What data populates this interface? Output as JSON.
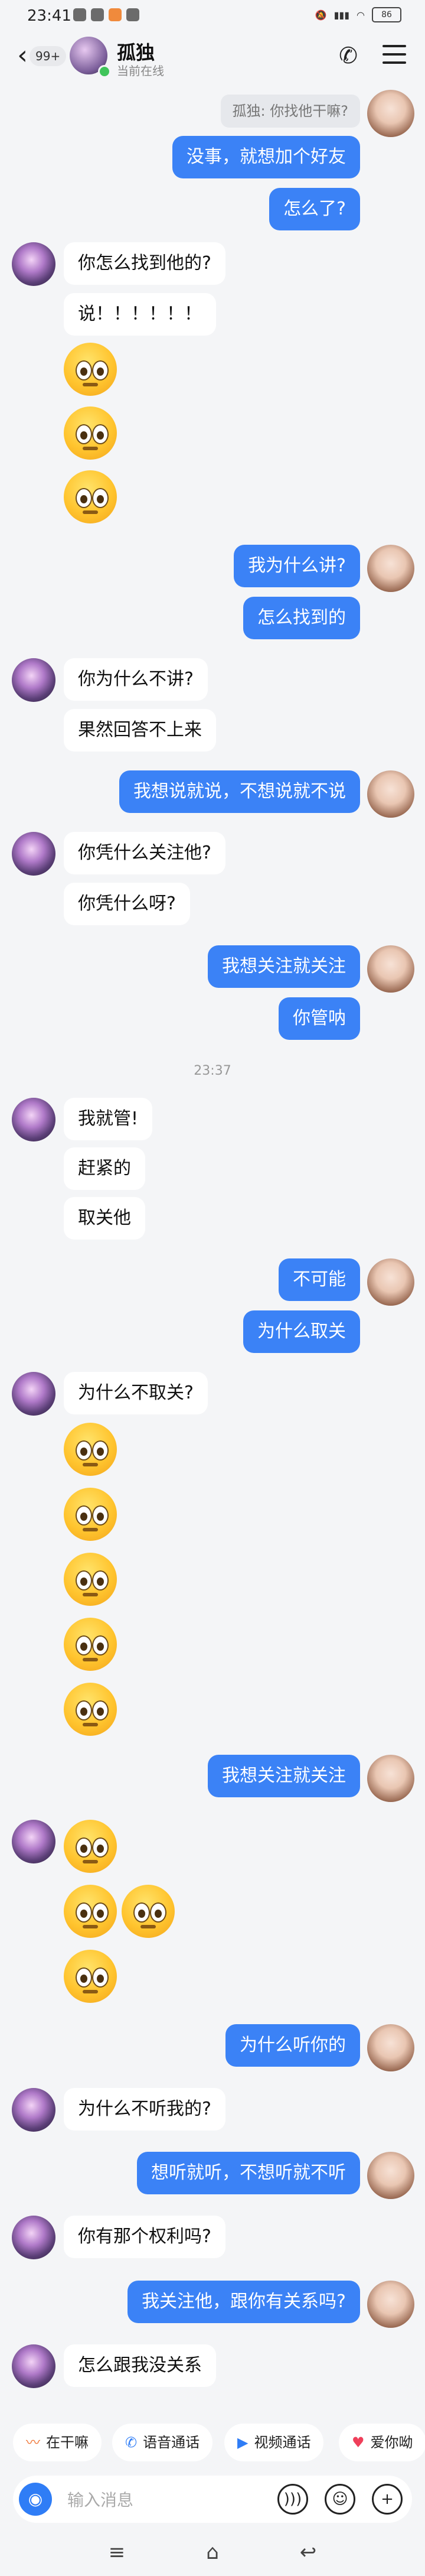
{
  "status_bar": {
    "time": "23:41",
    "battery": "86"
  },
  "header": {
    "unread_count": "99+",
    "contact_name": "孤独",
    "contact_status": "当前在线"
  },
  "messages": {
    "quote_1": "孤独: 你找他干嘛?",
    "m1": "没事，就想加个好友",
    "m2": "怎么了?",
    "m3": "你怎么找到他的?",
    "m4": "说！！！！！！",
    "m5": "我为什么讲?",
    "m6": "怎么找到的",
    "m7": "你为什么不讲?",
    "m8": "果然回答不上来",
    "m9": "我想说就说，不想说就不说",
    "m10": "你凭什么关注他?",
    "m11": "你凭什么呀?",
    "m12": "我想关注就关注",
    "m13": "你管呐",
    "timestamp_1": "23:37",
    "m14": "我就管!",
    "m15": "赶紧的",
    "m16": "取关他",
    "m17": "不可能",
    "m18": "为什么取关",
    "m19": "为什么不取关?",
    "m20": "我想关注就关注",
    "m21": "为什么听你的",
    "m22": "为什么不听我的?",
    "m23": "想听就听，不想听就不听",
    "m24": "你有那个权利吗?",
    "m25": "我关注他，跟你有关系吗?",
    "m26": "怎么跟我没关系"
  },
  "quick_actions": [
    {
      "label": "在干嘛",
      "icon": "wave-icon"
    },
    {
      "label": "语音通话",
      "icon": "phone-icon"
    },
    {
      "label": "视频通话",
      "icon": "video-icon"
    },
    {
      "label": "爱你呦",
      "icon": "heart-icon"
    }
  ],
  "input": {
    "placeholder": "输入消息"
  },
  "colors": {
    "outgoing_bubble": "#3b82f6",
    "incoming_bubble": "#ffffff",
    "background": "#f4f5f7"
  }
}
